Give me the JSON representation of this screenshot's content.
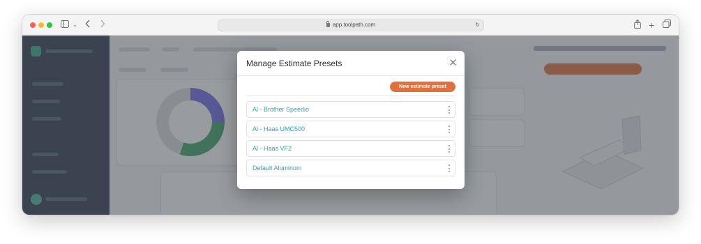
{
  "browser": {
    "url": "app.toolpath.com"
  },
  "modal": {
    "title": "Manage Estimate Presets",
    "new_button_label": "New estimate preset",
    "presets": [
      {
        "label": "Al - Brother Speedio"
      },
      {
        "label": "Al - Haas UMC500"
      },
      {
        "label": "Al - Haas VF2"
      },
      {
        "label": "Default Aluminum"
      }
    ]
  },
  "colors": {
    "accent": "#e0703e",
    "link": "#2ea6a8",
    "sidebar": "#2e3a4e"
  }
}
